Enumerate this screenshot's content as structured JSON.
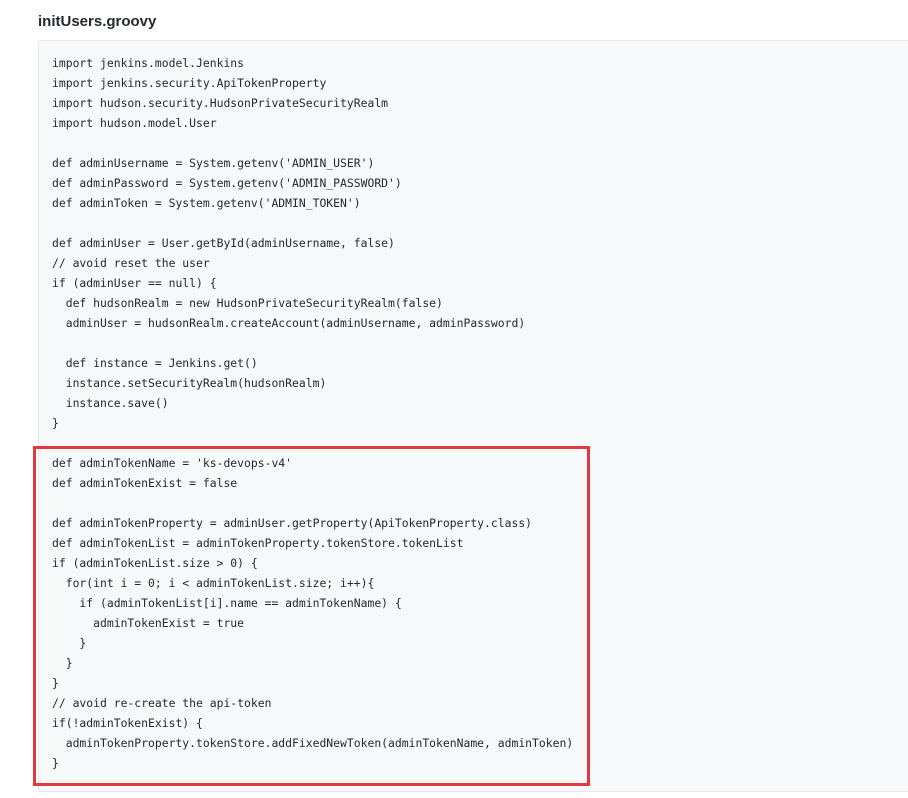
{
  "file": {
    "title": "initUsers.groovy"
  },
  "code": {
    "lines": [
      "import jenkins.model.Jenkins",
      "import jenkins.security.ApiTokenProperty",
      "import hudson.security.HudsonPrivateSecurityRealm",
      "import hudson.model.User",
      "",
      "def adminUsername = System.getenv('ADMIN_USER')",
      "def adminPassword = System.getenv('ADMIN_PASSWORD')",
      "def adminToken = System.getenv('ADMIN_TOKEN')",
      "",
      "def adminUser = User.getById(adminUsername, false)",
      "// avoid reset the user",
      "if (adminUser == null) {",
      "  def hudsonRealm = new HudsonPrivateSecurityRealm(false)",
      "  adminUser = hudsonRealm.createAccount(adminUsername, adminPassword)",
      "",
      "  def instance = Jenkins.get()",
      "  instance.setSecurityRealm(hudsonRealm)",
      "  instance.save()",
      "}",
      "",
      "def adminTokenName = 'ks-devops-v4'",
      "def adminTokenExist = false",
      "",
      "def adminTokenProperty = adminUser.getProperty(ApiTokenProperty.class)",
      "def adminTokenList = adminTokenProperty.tokenStore.tokenList",
      "if (adminTokenList.size > 0) {",
      "  for(int i = 0; i < adminTokenList.size; i++){",
      "    if (adminTokenList[i].name == adminTokenName) {",
      "      adminTokenExist = true",
      "    }",
      "  }",
      "}",
      "// avoid re-create the api-token",
      "if(!adminTokenExist) {",
      "  adminTokenProperty.tokenStore.addFixedNewToken(adminTokenName, adminToken)",
      "}"
    ]
  },
  "colors": {
    "highlight_border": "#e0393e",
    "code_background": "#f6f8fa",
    "text": "#24292e"
  }
}
